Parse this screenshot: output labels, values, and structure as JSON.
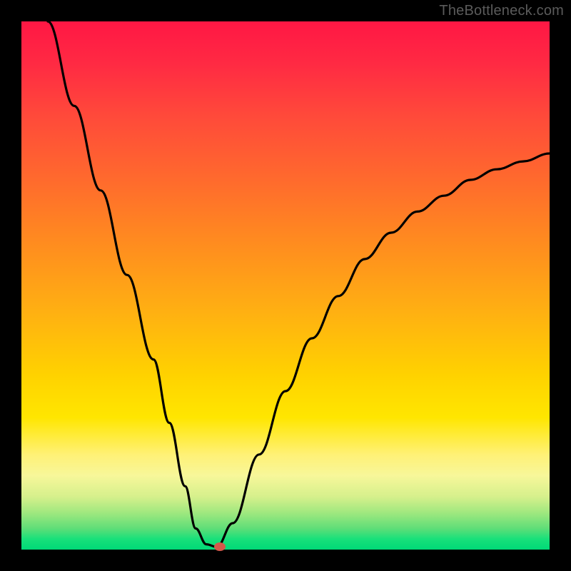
{
  "watermark": {
    "text": "TheBottleneck.com"
  },
  "colors": {
    "background": "#000000",
    "watermark": "#5b5b5b",
    "curve": "#000000",
    "dot": "#d4584a",
    "gradient_top": "#ff1744",
    "gradient_mid": "#ffd200",
    "gradient_bottom": "#00d977"
  },
  "chart_data": {
    "type": "line",
    "title": "",
    "xlabel": "",
    "ylabel": "",
    "xlim": [
      0,
      100
    ],
    "ylim": [
      0,
      100
    ],
    "grid": false,
    "legend": false,
    "series": [
      {
        "name": "bottleneck-curve",
        "x": [
          5,
          10,
          15,
          20,
          25,
          28,
          31,
          33,
          35,
          37,
          40,
          45,
          50,
          55,
          60,
          65,
          70,
          75,
          80,
          85,
          90,
          95,
          100
        ],
        "y": [
          100,
          84,
          68,
          52,
          36,
          24,
          12,
          4,
          1,
          0.5,
          5,
          18,
          30,
          40,
          48,
          55,
          60,
          64,
          67,
          70,
          72,
          73.5,
          75
        ]
      }
    ],
    "marker": {
      "x": 37.5,
      "y": 0.5,
      "color": "#d4584a"
    },
    "flat_segment": {
      "x_start": 33,
      "x_end": 36,
      "y": 0.5
    }
  }
}
